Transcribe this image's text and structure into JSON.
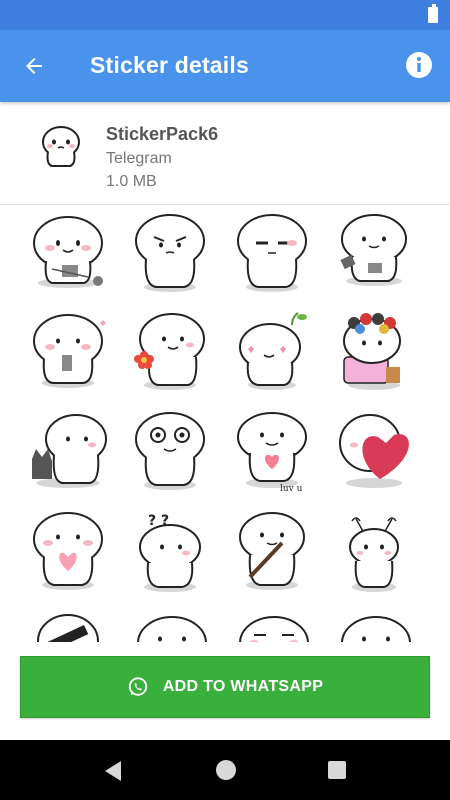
{
  "app_bar": {
    "title": "Sticker details",
    "back_icon": "arrow-left-icon",
    "info_icon": "info-icon"
  },
  "pack": {
    "name": "StickerPack6",
    "publisher": "Telegram",
    "size": "1.0 MB"
  },
  "stickers": [
    {
      "id": "s1",
      "pose": "holding-knitting"
    },
    {
      "id": "s2",
      "pose": "angry-face"
    },
    {
      "id": "s3",
      "pose": "annoyed-face"
    },
    {
      "id": "s4",
      "pose": "holding-phone"
    },
    {
      "id": "s5",
      "pose": "phone-blushing"
    },
    {
      "id": "s6",
      "pose": "holding-flower"
    },
    {
      "id": "s7",
      "pose": "sprout-hearts"
    },
    {
      "id": "s8",
      "pose": "curlers"
    },
    {
      "id": "s9",
      "pose": "with-cat"
    },
    {
      "id": "s10",
      "pose": "big-eyes"
    },
    {
      "id": "s11",
      "pose": "heart-love-u"
    },
    {
      "id": "s12",
      "pose": "big-heart"
    },
    {
      "id": "s13",
      "pose": "holding-heart"
    },
    {
      "id": "s14",
      "pose": "question-marks"
    },
    {
      "id": "s15",
      "pose": "holding-stick"
    },
    {
      "id": "s16",
      "pose": "antennae"
    },
    {
      "id": "s17",
      "pose": "sunglasses"
    },
    {
      "id": "s18",
      "pose": "partial"
    },
    {
      "id": "s19",
      "pose": "partial"
    },
    {
      "id": "s20",
      "pose": "partial"
    }
  ],
  "sticker_texts": {
    "love_u": "luv u",
    "q_marks": "? ?"
  },
  "add_button": {
    "label": "ADD TO WHATSAPP",
    "icon": "whatsapp-icon"
  },
  "nav": {
    "back_icon": "nav-back-icon",
    "home_icon": "nav-home-icon",
    "recent_icon": "nav-recent-icon"
  },
  "colors": {
    "status_bar": "#3f7fe0",
    "app_bar": "#4a93ec",
    "add_button": "#3aaf3c"
  }
}
